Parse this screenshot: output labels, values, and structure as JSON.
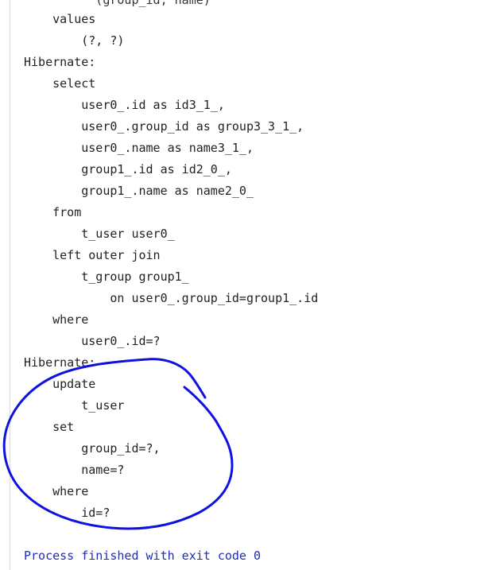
{
  "console": {
    "lines": [
      {
        "text": "          (group_id, name)",
        "kind": "partial"
      },
      {
        "text": "    values",
        "kind": "normal"
      },
      {
        "text": "        (?, ?)",
        "kind": "normal"
      },
      {
        "text": "Hibernate:",
        "kind": "normal"
      },
      {
        "text": "    select",
        "kind": "normal"
      },
      {
        "text": "        user0_.id as id3_1_,",
        "kind": "normal"
      },
      {
        "text": "        user0_.group_id as group3_3_1_,",
        "kind": "normal"
      },
      {
        "text": "        user0_.name as name3_1_,",
        "kind": "normal"
      },
      {
        "text": "        group1_.id as id2_0_,",
        "kind": "normal"
      },
      {
        "text": "        group1_.name as name2_0_",
        "kind": "normal"
      },
      {
        "text": "    from",
        "kind": "normal"
      },
      {
        "text": "        t_user user0_",
        "kind": "normal"
      },
      {
        "text": "    left outer join",
        "kind": "normal"
      },
      {
        "text": "        t_group group1_",
        "kind": "normal"
      },
      {
        "text": "            on user0_.group_id=group1_.id",
        "kind": "normal"
      },
      {
        "text": "    where",
        "kind": "normal"
      },
      {
        "text": "        user0_.id=?",
        "kind": "normal"
      },
      {
        "text": "Hibernate:",
        "kind": "normal"
      },
      {
        "text": "    update",
        "kind": "normal"
      },
      {
        "text": "        t_user",
        "kind": "normal"
      },
      {
        "text": "    set",
        "kind": "normal"
      },
      {
        "text": "        group_id=?,",
        "kind": "normal"
      },
      {
        "text": "        name=?",
        "kind": "normal"
      },
      {
        "text": "    where",
        "kind": "normal"
      },
      {
        "text": "        id=?",
        "kind": "normal"
      },
      {
        "text": "",
        "kind": "blank"
      },
      {
        "text": "Process finished with exit code 0",
        "kind": "exit"
      }
    ]
  },
  "colors": {
    "text": "#222222",
    "exit_text": "#1f2db4",
    "annotation_ink": "#1010e0",
    "gutter": "#d9d9d9"
  }
}
